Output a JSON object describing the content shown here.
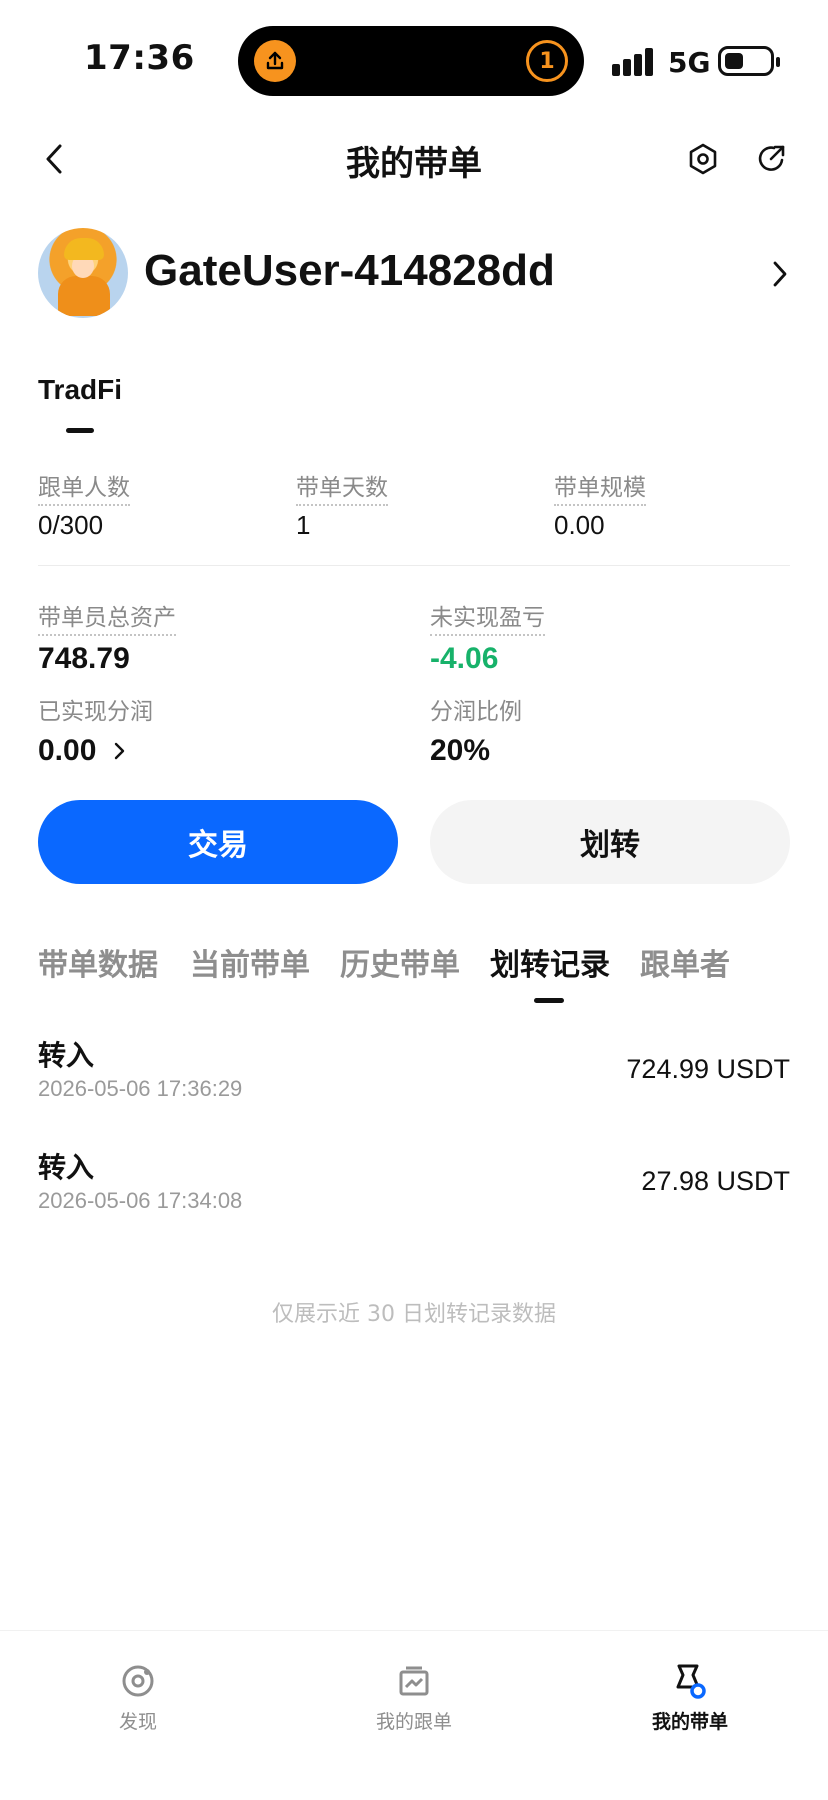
{
  "status_bar": {
    "time": "17:36",
    "island_badge": "1",
    "network": "5G"
  },
  "header": {
    "title": "我的带单"
  },
  "profile": {
    "username": "GateUser-414828dd"
  },
  "category": "TradFi",
  "stats_top": [
    {
      "label": "跟单人数",
      "value": "0/300"
    },
    {
      "label": "带单天数",
      "value": "1"
    },
    {
      "label": "带单规模",
      "value": "0.00"
    }
  ],
  "assets": {
    "total_label": "带单员总资产",
    "total_value": "748.79",
    "unrealized_label": "未实现盈亏",
    "unrealized_value": "-4.06",
    "realized_label": "已实现分润",
    "realized_value": "0.00",
    "share_label": "分润比例",
    "share_value": "20%"
  },
  "actions": {
    "trade": "交易",
    "transfer": "划转"
  },
  "tabs": [
    {
      "label": "带单数据",
      "active": false
    },
    {
      "label": "当前带单",
      "active": false
    },
    {
      "label": "历史带单",
      "active": false
    },
    {
      "label": "划转记录",
      "active": true
    },
    {
      "label": "跟单者",
      "active": false
    }
  ],
  "records": [
    {
      "type": "转入",
      "time": "2026-05-06 17:36:29",
      "amount": "724.99 USDT"
    },
    {
      "type": "转入",
      "time": "2026-05-06 17:34:08",
      "amount": "27.98 USDT"
    }
  ],
  "footnote": "仅展示近 30 日划转记录数据",
  "bottom_nav": [
    {
      "label": "发现",
      "icon": "discover-icon",
      "active": false
    },
    {
      "label": "我的跟单",
      "icon": "copy-trading-icon",
      "active": false
    },
    {
      "label": "我的带单",
      "icon": "lead-trading-icon",
      "active": true
    }
  ],
  "colors": {
    "accent": "#0a68ff",
    "profit_negative_shown": "#17b26a",
    "island_orange": "#f7931e"
  }
}
